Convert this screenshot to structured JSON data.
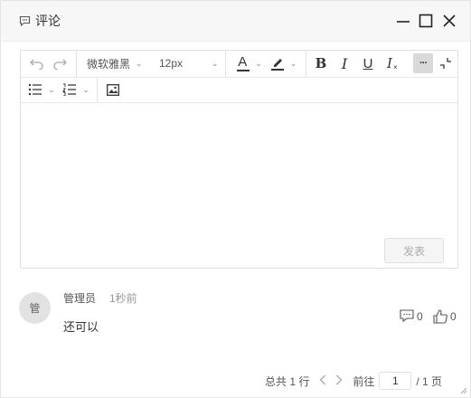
{
  "dialog": {
    "title": "评论",
    "icons": {
      "title": "comment-icon",
      "minimize": "minimize-icon",
      "maximize": "maximize-icon",
      "close": "close-icon"
    }
  },
  "editor": {
    "toolbar": {
      "font_family": "微软雅黑",
      "font_size": "12px",
      "font_color_label": "A",
      "bold_label": "B",
      "italic_label": "I",
      "underline_label": "U",
      "clear_format_label": "I",
      "more_label": "···"
    },
    "content": "",
    "publish_label": "发表",
    "colors": {
      "border": "#dcdfe6",
      "publish_text": "#a8abb2"
    }
  },
  "comments": [
    {
      "avatar_text": "管",
      "author": "管理员",
      "time": "1秒前",
      "text": "还可以",
      "reply_count": "0",
      "like_count": "0"
    }
  ],
  "pagination": {
    "total_text": "总共 1 行",
    "goto_label": "前往",
    "current_page": "1",
    "total_pages_text": "/ 1 页"
  }
}
